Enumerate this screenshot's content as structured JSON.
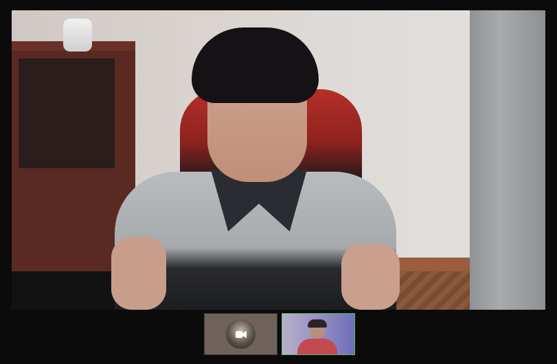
{
  "call": {
    "main_participant": "remote-video",
    "thumbnails": [
      {
        "id": "participant-1",
        "state": "camera-off",
        "icon": "video-camera-icon"
      },
      {
        "id": "participant-2",
        "state": "video-on",
        "active": true
      }
    ]
  },
  "colors": {
    "background": "#0b0b0b",
    "active_border": "#5cbf63"
  }
}
